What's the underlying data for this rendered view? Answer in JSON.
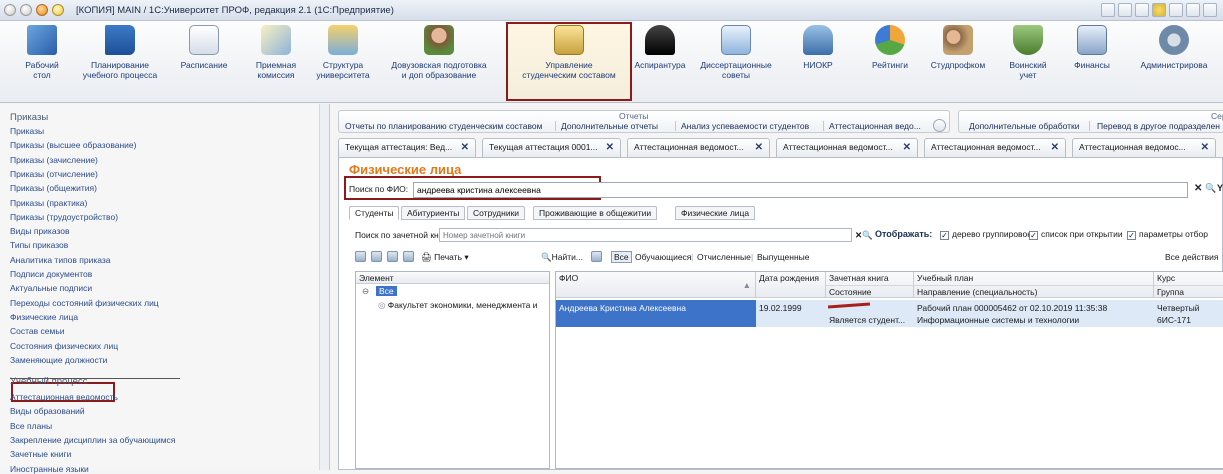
{
  "window": {
    "title": "[КОПИЯ] MAIN / 1С:Университет ПРОФ, редакция 2.1 (1С:Предприятие)"
  },
  "sections": [
    {
      "label": "Рабочий\nстол",
      "icon": "desktop-icon"
    },
    {
      "label": "Планирование\nучебного процесса",
      "icon": "book-icon"
    },
    {
      "label": "Расписание",
      "icon": "calendar-icon"
    },
    {
      "label": "Приемная\nкомиссия",
      "icon": "pen-icon"
    },
    {
      "label": "Структура\nуниверситета",
      "icon": "structure-icon"
    },
    {
      "label": "Довузовская подготовка\nи доп образование",
      "icon": "people-icon"
    },
    {
      "label": "Управление\nстуденческим составом",
      "icon": "student-card-icon"
    },
    {
      "label": "Аспирантура",
      "icon": "graduation-cap-icon"
    },
    {
      "label": "Диссертационные\nсоветы",
      "icon": "document-icon"
    },
    {
      "label": "НИОКР",
      "icon": "microscope-icon"
    },
    {
      "label": "Рейтинги",
      "icon": "pie-chart-icon"
    },
    {
      "label": "Студпрофком",
      "icon": "union-icon"
    },
    {
      "label": "Воинский\nучет",
      "icon": "shield-icon"
    },
    {
      "label": "Финансы",
      "icon": "calculator-icon"
    },
    {
      "label": "Администрирова",
      "icon": "gear-icon"
    }
  ],
  "sidebar": {
    "group1": "Приказы",
    "items1": [
      "Приказы",
      "Приказы (высшее образование)",
      "Приказы (зачисление)",
      "Приказы (отчисление)",
      "Приказы (общежития)",
      "Приказы (практика)",
      "Приказы (трудоустройство)",
      "Виды приказов",
      "Типы приказов",
      "Аналитика типов приказа",
      "Подписи документов",
      "Актуальные подписи",
      "Переходы состояний физических лиц",
      "Физические лица",
      "Состав семьи",
      "Состояния физических лиц",
      "Заменяющие должности"
    ],
    "group2": "Учебный процесс",
    "items2": [
      "Аттестационная ведомость",
      "Виды образований",
      "Все планы",
      "Закрепление дисциплин за обучающимся",
      "Зачетные книги",
      "Иностранные языки"
    ]
  },
  "reports_bar": {
    "title": "Отчеты",
    "items": [
      "Отчеты по планированию студенческим составом",
      "Дополнительные отчеты",
      "Анализ успеваемости студентов",
      "Аттестационная ведо..."
    ],
    "services_title": "Сер",
    "services": [
      "Дополнительные обработки",
      "Перевод в другое подразделен"
    ]
  },
  "open_tabs": [
    "Текущая аттестация: Вед...",
    "Текущая аттестация 0001...",
    "Аттестационная ведомост...",
    "Аттестационная ведомост...",
    "Аттестационная ведомост...",
    "Аттестационная ведомос..."
  ],
  "form": {
    "title": "Физические лица",
    "search_label": "Поиск по ФИО:",
    "search_value": "андреева кристина алексеевна",
    "search_extra": "Y",
    "subtabs": [
      "Студенты",
      "Абитуриенты",
      "Сотрудники",
      "Проживающие в общежитии",
      "Физические лица"
    ],
    "record_book_label": "Поиск по зачетной книге:",
    "record_book_placeholder": "Номер зачетной книги",
    "display_label": "Отображать:",
    "display_options": [
      "дерево группировок",
      "список при открытии",
      "параметры отбор"
    ],
    "print_label": "Печать",
    "find_label": "Найти...",
    "filters": [
      "Все",
      "Обучающиеся",
      "Отчисленные",
      "Выпущенные"
    ],
    "all_actions": "Все действия"
  },
  "tree": {
    "header": "Элемент",
    "root": "Все",
    "child": "Факультет экономики, менеджмента и"
  },
  "grid": {
    "columns": [
      {
        "top": "ФИО",
        "bottom": ""
      },
      {
        "top": "Дата рождения",
        "bottom": ""
      },
      {
        "top": "Зачетная книга",
        "bottom": "Состояние"
      },
      {
        "top": "Учебный план",
        "bottom": "Направление (специальность)"
      },
      {
        "top": "Курс",
        "bottom": "Группа"
      }
    ],
    "rows": [
      {
        "fio": "Андреева Кристина Алексеевна",
        "birth": "19.02.1999",
        "book": "",
        "state": "Является студент...",
        "plan": "Рабочий план 000005462 от 02.10.2019 11:35:38",
        "direction": "Информационные системы и технологии",
        "course": "Четвертый",
        "group": "6ИС-171"
      }
    ]
  }
}
